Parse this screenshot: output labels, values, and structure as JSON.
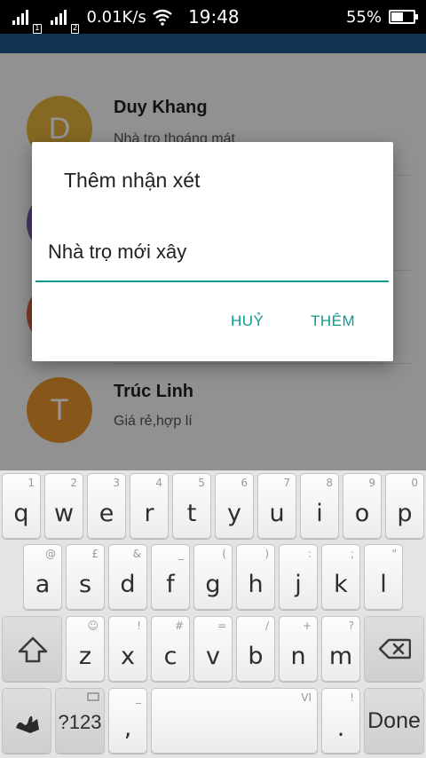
{
  "status_bar": {
    "speed": "0.01K/s",
    "time": "19:48",
    "battery": "55%",
    "battery_level": 0.55,
    "sim1": "1",
    "sim2": "2"
  },
  "list": [
    {
      "initial": "D",
      "name": "Duy Khang",
      "comment": "Nhà trọ thoáng mát",
      "color": "#e6b43a"
    },
    {
      "initial": "",
      "name": "",
      "comment": "",
      "color": "#7b5bb3"
    },
    {
      "initial": "",
      "name": "",
      "comment": "",
      "color": "#d9643e"
    },
    {
      "initial": "T",
      "name": "Trúc Linh",
      "comment": "Giá rẻ,hợp lí",
      "color": "#e8962e"
    }
  ],
  "dialog": {
    "title": "Thêm nhận xét",
    "input_value": "Nhà trọ mới xây",
    "cancel_label": "HUỶ",
    "add_label": "THÊM",
    "accent_color": "#11998e"
  },
  "keyboard": {
    "row1": [
      {
        "main": "q",
        "hint": "1"
      },
      {
        "main": "w",
        "hint": "2"
      },
      {
        "main": "e",
        "hint": "3"
      },
      {
        "main": "r",
        "hint": "4"
      },
      {
        "main": "t",
        "hint": "5"
      },
      {
        "main": "y",
        "hint": "6"
      },
      {
        "main": "u",
        "hint": "7"
      },
      {
        "main": "i",
        "hint": "8"
      },
      {
        "main": "o",
        "hint": "9"
      },
      {
        "main": "p",
        "hint": "0"
      }
    ],
    "row2": [
      {
        "main": "a",
        "hint": "@"
      },
      {
        "main": "s",
        "hint": "£"
      },
      {
        "main": "d",
        "hint": "&"
      },
      {
        "main": "f",
        "hint": "_"
      },
      {
        "main": "g",
        "hint": "("
      },
      {
        "main": "h",
        "hint": ")"
      },
      {
        "main": "j",
        "hint": ":"
      },
      {
        "main": "k",
        "hint": ";"
      },
      {
        "main": "l",
        "hint": "\""
      }
    ],
    "row3": [
      {
        "main": "z",
        "hint": "☺"
      },
      {
        "main": "x",
        "hint": "!"
      },
      {
        "main": "c",
        "hint": "#"
      },
      {
        "main": "v",
        "hint": "="
      },
      {
        "main": "b",
        "hint": "/"
      },
      {
        "main": "n",
        "hint": "+"
      },
      {
        "main": "m",
        "hint": "?"
      }
    ],
    "symbols_label": "?123",
    "comma_main": ",",
    "comma_hint": "_",
    "space_hint": "VI",
    "period_main": ".",
    "period_hint": "!",
    "done_label": "Done",
    "icons": {
      "shift": "shift-arrow-icon",
      "backspace": "backspace-icon",
      "swype": "swype-logo-icon",
      "emoji_hint": "keyboard-small-icon"
    }
  }
}
